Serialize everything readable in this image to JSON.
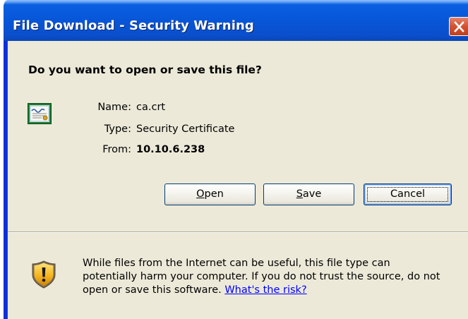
{
  "window": {
    "title": "File Download - Security Warning"
  },
  "dialog": {
    "question": "Do you want to open or save this file?",
    "file": {
      "name_label": "Name:",
      "name_value": "ca.crt",
      "type_label": "Type:",
      "type_value": "Security Certificate",
      "from_label": "From:",
      "from_value": "10.10.6.238"
    },
    "buttons": {
      "open_accel": "O",
      "open_rest": "pen",
      "save_accel": "S",
      "save_rest": "ave",
      "cancel": "Cancel"
    },
    "warning": {
      "line1": "While files from the Internet can be useful, this file type can",
      "line2": "potentially harm your computer. If you do not trust the source, do not",
      "line3_prefix": "open or save this software.",
      "risk_link": "What's the risk?"
    }
  },
  "icons": {
    "file": "certificate-icon",
    "warning": "security-shield-icon",
    "close": "close-icon"
  },
  "colors": {
    "titlebar": "#0856d8",
    "dialog_background": "#ece9d8",
    "close_button": "#d2522f",
    "link": "#0000ff",
    "button_border": "#003c74"
  }
}
